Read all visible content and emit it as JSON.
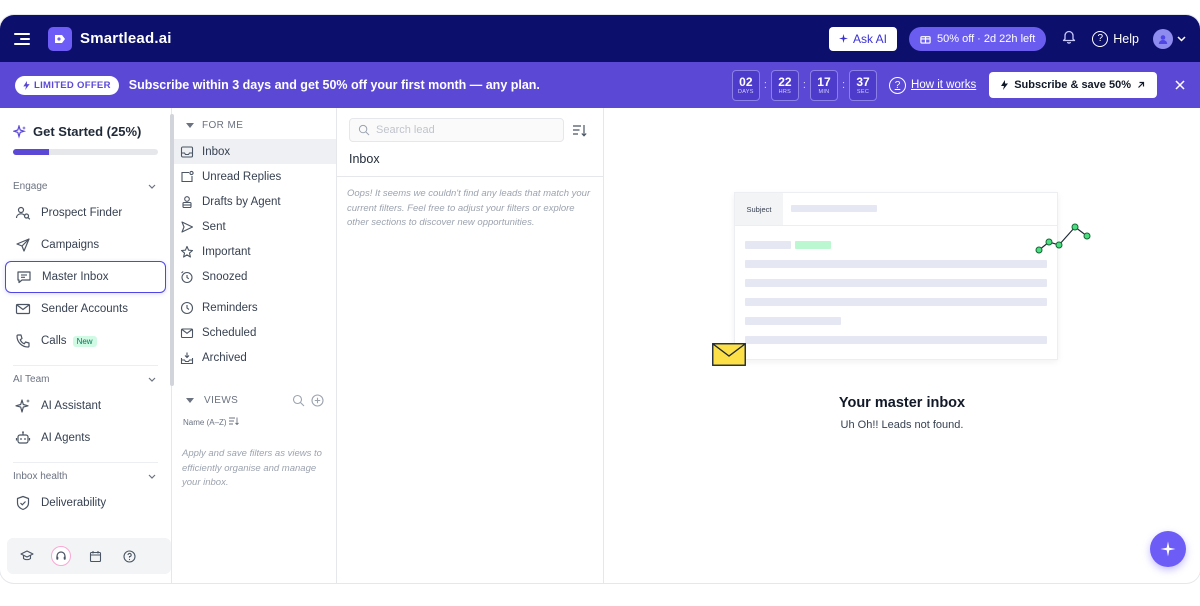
{
  "topbar": {
    "logo_text": "Smartlead.ai",
    "ask_ai_label": "Ask AI",
    "offer_pill": "50% off · 2d 22h left",
    "help_label": "Help"
  },
  "banner": {
    "limited_label": "LIMITED OFFER",
    "text": "Subscribe within 3 days and get 50% off your first month — any plan.",
    "timer": [
      {
        "value": "02",
        "unit": "DAYS"
      },
      {
        "value": "22",
        "unit": "HRS"
      },
      {
        "value": "17",
        "unit": "MIN"
      },
      {
        "value": "37",
        "unit": "SEC"
      }
    ],
    "how_label": "How it works",
    "subscribe_label": "Subscribe & save 50%",
    "accent": "#5b49d6"
  },
  "sidebar": {
    "get_started": "Get Started (25%)",
    "progress": 0.25,
    "sections": {
      "engage": "Engage",
      "ai_team": "AI Team",
      "inbox_health": "Inbox health"
    },
    "items": {
      "prospect_finder": "Prospect Finder",
      "campaigns": "Campaigns",
      "master_inbox": "Master Inbox",
      "sender_accounts": "Sender Accounts",
      "calls": "Calls",
      "calls_badge": "New",
      "ai_assistant": "AI Assistant",
      "ai_agents": "AI Agents",
      "deliverability": "Deliverability"
    }
  },
  "folders": {
    "header": "FOR ME",
    "items": {
      "inbox": "Inbox",
      "unread": "Unread Replies",
      "drafts": "Drafts by Agent",
      "sent": "Sent",
      "important": "Important",
      "snoozed": "Snoozed",
      "reminders": "Reminders",
      "scheduled": "Scheduled",
      "archived": "Archived"
    },
    "views_header": "VIEWS",
    "sort_label": "Name (A–Z)",
    "views_hint": "Apply and save filters as views to efficiently organise and manage your inbox."
  },
  "leads": {
    "search_placeholder": "Search lead",
    "title": "Inbox",
    "empty_text": "Oops! It seems we couldn't find any leads that match your current filters. Feel free to adjust your filters or explore other sections to discover new opportunities."
  },
  "main": {
    "card_subject": "Subject",
    "empty_title": "Your master inbox",
    "empty_sub": "Uh Oh!! Leads not found."
  }
}
